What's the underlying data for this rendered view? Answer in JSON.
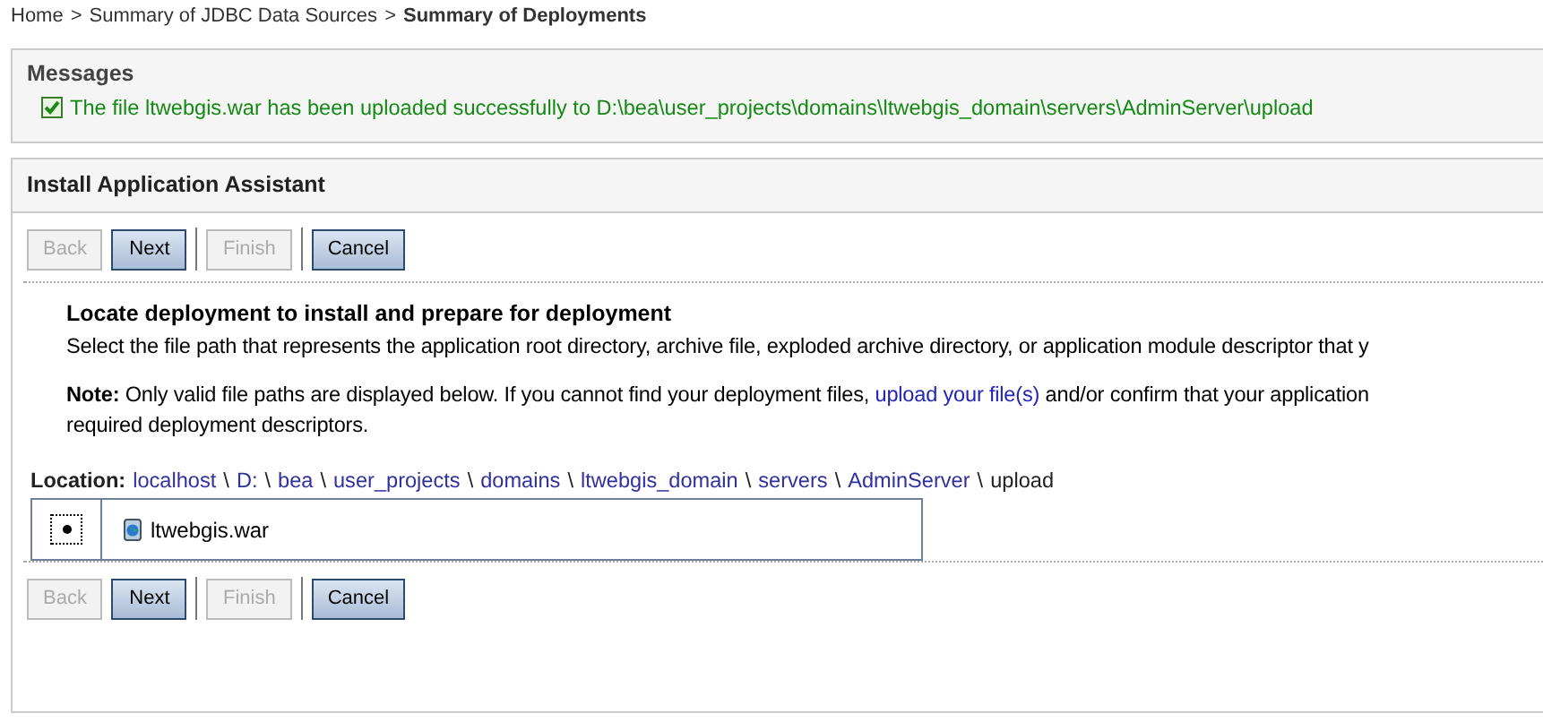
{
  "breadcrumb": [
    {
      "label": "Home",
      "current": false
    },
    {
      "label": "Summary of JDBC Data Sources",
      "current": false
    },
    {
      "label": "Summary of Deployments",
      "current": true
    }
  ],
  "breadcrumb_separator": ">",
  "messages": {
    "title": "Messages",
    "items": [
      {
        "text": "The file ltwebgis.war has been uploaded successfully to D:\\bea\\user_projects\\domains\\ltwebgis_domain\\servers\\AdminServer\\upload"
      }
    ]
  },
  "assistant": {
    "title": "Install Application Assistant",
    "top_buttons": [
      {
        "label": "Back",
        "disabled": true
      },
      {
        "label": "Next",
        "disabled": false
      },
      {
        "label": "Finish",
        "disabled": true
      },
      {
        "label": "Cancel",
        "disabled": false
      }
    ],
    "heading": "Locate deployment to install and prepare for deployment",
    "description": "Select the file path that represents the application root directory, archive file, exploded archive directory, or application module descriptor that y",
    "note": {
      "label": "Note:",
      "before": "Only valid file paths are displayed below. If you cannot find your deployment files,",
      "link": "upload your file(s)",
      "after": "and/or confirm that your application",
      "line2": "required deployment descriptors."
    },
    "location": {
      "label": "Location:",
      "separator": "\\",
      "segments": [
        {
          "label": "localhost",
          "link": true
        },
        {
          "label": "D:",
          "link": true
        },
        {
          "label": "bea",
          "link": true
        },
        {
          "label": "user_projects",
          "link": true
        },
        {
          "label": "domains",
          "link": true
        },
        {
          "label": "ltwebgis_domain",
          "link": true
        },
        {
          "label": "servers",
          "link": true
        },
        {
          "label": "AdminServer",
          "link": true
        },
        {
          "label": "upload",
          "link": false
        }
      ]
    },
    "files": [
      {
        "name": "ltwebgis.war",
        "selected": true
      }
    ],
    "bottom_buttons": [
      {
        "label": "Back",
        "disabled": true
      },
      {
        "label": "Next",
        "disabled": false
      },
      {
        "label": "Finish",
        "disabled": true
      },
      {
        "label": "Cancel",
        "disabled": false
      }
    ]
  }
}
